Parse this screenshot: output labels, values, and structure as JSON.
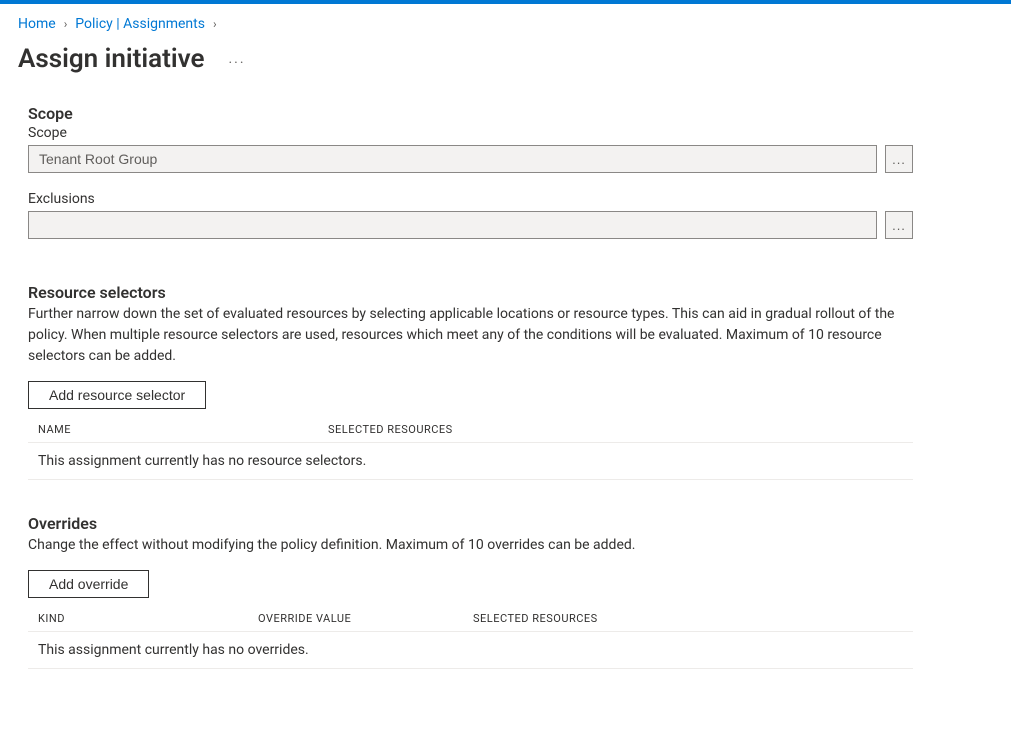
{
  "breadcrumb": {
    "home": "Home",
    "policy": "Policy | Assignments"
  },
  "pageTitle": "Assign initiative",
  "scope": {
    "heading": "Scope",
    "scopeLabel": "Scope",
    "scopeValue": "Tenant Root Group",
    "exclusionsLabel": "Exclusions",
    "exclusionsValue": ""
  },
  "resourceSelectors": {
    "heading": "Resource selectors",
    "desc": "Further narrow down the set of evaluated resources by selecting applicable locations or resource types. This can aid in gradual rollout of the policy. When multiple resource selectors are used, resources which meet any of the conditions will be evaluated. Maximum of 10 resource selectors can be added.",
    "addBtn": "Add resource selector",
    "colName": "NAME",
    "colSelected": "SELECTED RESOURCES",
    "empty": "This assignment currently has no resource selectors."
  },
  "overrides": {
    "heading": "Overrides",
    "desc": "Change the effect without modifying the policy definition. Maximum of 10 overrides can be added.",
    "addBtn": "Add override",
    "colKind": "KIND",
    "colOverride": "OVERRIDE VALUE",
    "colSelected": "SELECTED RESOURCES",
    "empty": "This assignment currently has no overrides."
  },
  "icons": {
    "ellipsis": "...",
    "chevron": "›"
  }
}
